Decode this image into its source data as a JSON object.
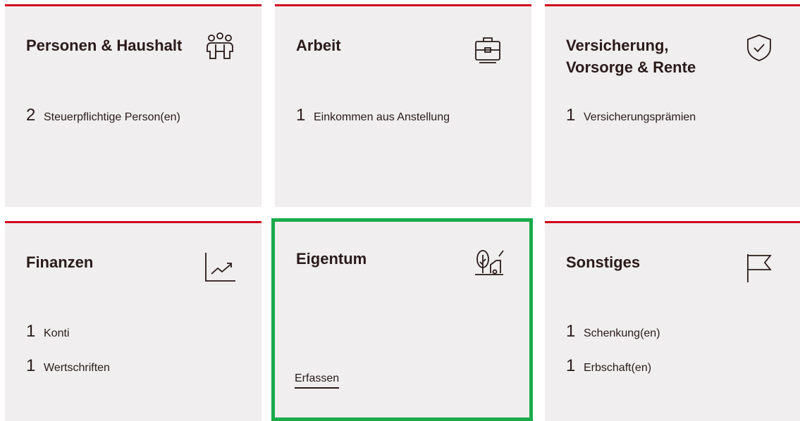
{
  "tiles": {
    "personen": {
      "title": "Personen & Haushalt",
      "icon": "people-group-icon",
      "stats": [
        {
          "count": "2",
          "label": "Steuerpflichtige Person(en)"
        }
      ]
    },
    "arbeit": {
      "title": "Arbeit",
      "icon": "briefcase-icon",
      "stats": [
        {
          "count": "1",
          "label": "Einkommen aus Anstellung"
        }
      ]
    },
    "versicherung": {
      "title": "Versicherung, Vorsorge & Rente",
      "icon": "shield-check-icon",
      "stats": [
        {
          "count": "1",
          "label": "Versicherungsprämien"
        }
      ]
    },
    "finanzen": {
      "title": "Finanzen",
      "icon": "trend-chart-icon",
      "stats": [
        {
          "count": "1",
          "label": "Konti"
        },
        {
          "count": "1",
          "label": "Wertschriften"
        }
      ]
    },
    "eigentum": {
      "title": "Eigentum",
      "icon": "tree-car-property-icon",
      "action": "Erfassen"
    },
    "sonstiges": {
      "title": "Sonstiges",
      "icon": "flag-icon",
      "stats": [
        {
          "count": "1",
          "label": "Schenkung(en)"
        },
        {
          "count": "1",
          "label": "Erbschaft(en)"
        }
      ]
    }
  },
  "colors": {
    "accent_top": "#d0021b",
    "selected_border": "#1aab4b",
    "tile_bg": "#f0eeee",
    "text": "#2a1a1a"
  }
}
